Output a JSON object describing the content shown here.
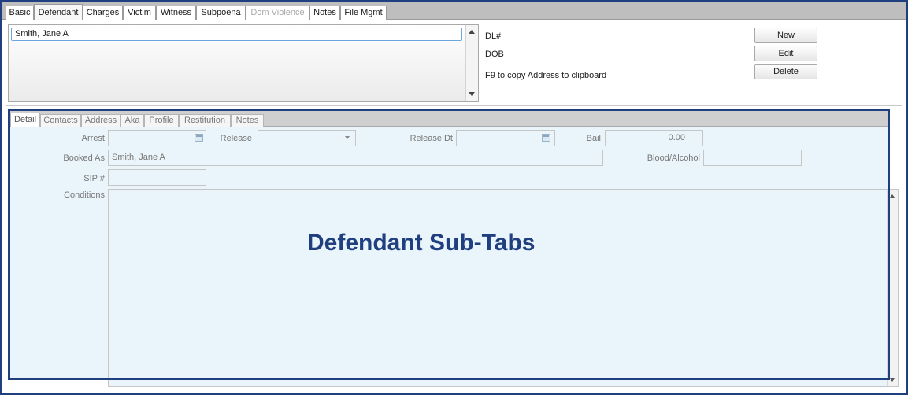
{
  "tabs": [
    {
      "label": "Basic",
      "state": "normal"
    },
    {
      "label": "Defendant",
      "state": "active"
    },
    {
      "label": "Charges",
      "state": "normal"
    },
    {
      "label": "Victim",
      "state": "normal"
    },
    {
      "label": "Witness",
      "state": "normal"
    },
    {
      "label": "Subpoena",
      "state": "normal"
    },
    {
      "label": "Dom Violence",
      "state": "disabled"
    },
    {
      "label": "Notes",
      "state": "normal"
    },
    {
      "label": "File Mgmt",
      "state": "normal"
    }
  ],
  "defendant_list": {
    "items": [
      "Smith, Jane A"
    ]
  },
  "info": {
    "dl": "DL#",
    "dob": "DOB",
    "f9_hint": "F9 to copy Address to clipboard"
  },
  "buttons": {
    "new": "New",
    "edit": "Edit",
    "delete": "Delete"
  },
  "subtabs": [
    {
      "label": "Detail",
      "state": "active"
    },
    {
      "label": "Contacts",
      "state": "normal"
    },
    {
      "label": "Address",
      "state": "normal"
    },
    {
      "label": "Aka",
      "state": "normal"
    },
    {
      "label": "Profile",
      "state": "normal"
    },
    {
      "label": "Restitution",
      "state": "normal"
    },
    {
      "label": "Notes",
      "state": "normal"
    }
  ],
  "detail": {
    "arrest_label": "Arrest",
    "arrest_value": "",
    "release_label": "Release",
    "release_value": "",
    "release_dt_label": "Release Dt",
    "release_dt_value": "",
    "bail_label": "Bail",
    "bail_value": "0.00",
    "booked_as_label": "Booked As",
    "booked_as_value": "Smith, Jane A",
    "blood_alcohol_label": "Blood/Alcohol",
    "blood_alcohol_value": "",
    "sip_label": "SIP #",
    "sip_value": "",
    "conditions_label": "Conditions",
    "conditions_value": ""
  },
  "callout": {
    "text": "Defendant Sub-Tabs",
    "color": "#1f3f7f"
  },
  "colors": {
    "frame": "#1f3f7f",
    "panel": "#eaf5fb",
    "selection": "#6ba6e0"
  }
}
